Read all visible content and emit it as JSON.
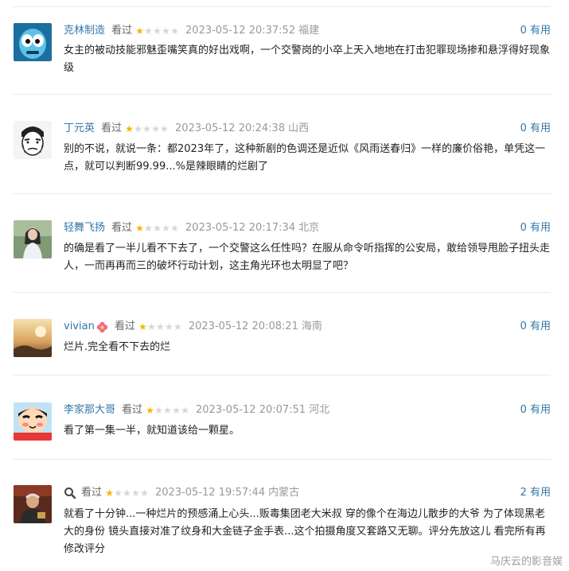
{
  "reviews": [
    {
      "user": "克林制造",
      "status": "看过",
      "rating": 1,
      "date": "2023-05-12 20:37:52",
      "location": "福建",
      "useful": "0 有用",
      "avatar_icon": "blue-monster-avatar",
      "text": "女主的被动技能邪魅歪嘴笑真的好出戏啊，一个交警岗的小卒上天入地地在打击犯罪现场掺和悬浮得好现象级"
    },
    {
      "user": "丁元英",
      "status": "看过",
      "rating": 1,
      "date": "2023-05-12 20:24:38",
      "location": "山西",
      "useful": "0 有用",
      "avatar_icon": "sketch-face-avatar",
      "text": "别的不说，就说一条：都2023年了，这种新剧的色调还是近似《风雨送春归》一样的廉价俗艳，单凭这一点，就可以判断99.99...%是辣眼睛的烂剧了"
    },
    {
      "user": "轻舞飞扬",
      "status": "看过",
      "rating": 1,
      "date": "2023-05-12 20:17:34",
      "location": "北京",
      "useful": "0 有用",
      "avatar_icon": "girl-photo-avatar",
      "text": "的确是看了一半儿看不下去了，一个交警这么任性吗？在服从命令听指挥的公安局，敢给领导甩脸子扭头走人，一而再再而三的破坏行动计划，这主角光环也太明显了吧？"
    },
    {
      "user": "vivian",
      "status": "看过",
      "rating": 1,
      "date": "2023-05-12 20:08:21",
      "location": "海南",
      "useful": "0 有用",
      "avatar_icon": "sunset-photo-avatar",
      "text": "烂片.完全看不下去的烂"
    },
    {
      "user": "李家那大哥",
      "status": "看过",
      "rating": 1,
      "date": "2023-05-12 20:07:51",
      "location": "河北",
      "useful": "0 有用",
      "avatar_icon": "cartoon-boy-avatar",
      "text": "看了第一集一半，就知道该给一颗星。"
    },
    {
      "user": "",
      "status": "看过",
      "rating": 1,
      "date": "2023-05-12 19:57:44",
      "location": "内蒙古",
      "useful": "2 有用",
      "avatar_icon": "old-man-photo-avatar",
      "text": "就看了十分钟...一种烂片的预感涌上心头...贩毒集团老大米叔 穿的像个在海边儿散步的大爷 为了体现黑老大的身份 镜头直接对准了纹身和大金链子金手表...这个拍摄角度又套路又无聊。评分先放这儿 看完所有再修改评分"
    }
  ],
  "watermark": "马庆云的影音娱",
  "colors": {
    "link": "#3377aa",
    "star_on": "#f7b500",
    "star_off": "#d6d6d6",
    "meta": "#999999"
  }
}
